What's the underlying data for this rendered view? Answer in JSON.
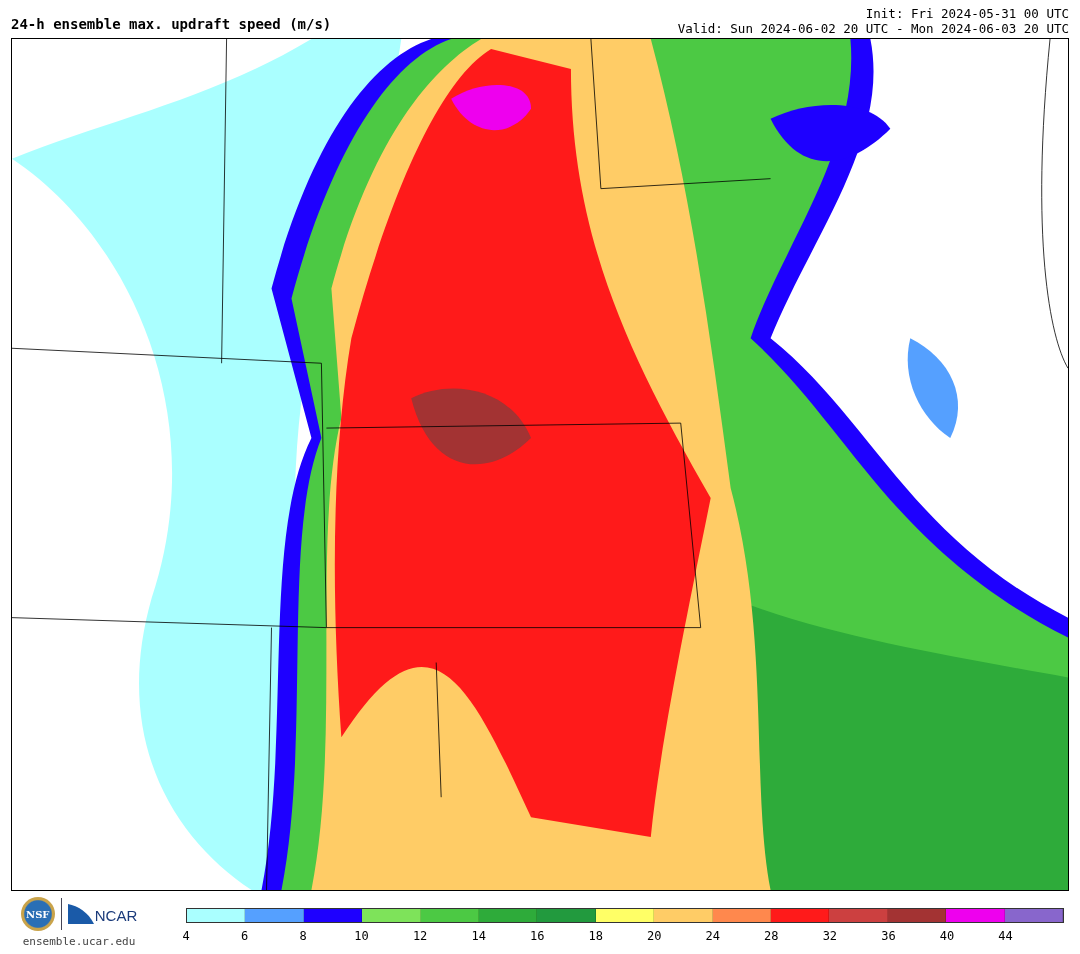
{
  "title": "24-h ensemble max. updraft speed (m/s)",
  "init": "Init: Fri 2024-05-31 00 UTC",
  "valid": "Valid: Sun 2024-06-02 20 UTC - Mon 2024-06-03 20 UTC",
  "footer": {
    "nsf_logo": "NSF",
    "ncar_logo": "NCAR",
    "url": "ensemble.ucar.edu"
  },
  "colorbar": {
    "segments": [
      {
        "color": "#aaffff"
      },
      {
        "color": "#55a0ff"
      },
      {
        "color": "#1e00ff"
      },
      {
        "color": "#7ee35a"
      },
      {
        "color": "#4cc944"
      },
      {
        "color": "#2eab3a"
      },
      {
        "color": "#229a3e"
      },
      {
        "color": "#ffff66"
      },
      {
        "color": "#ffcc66"
      },
      {
        "color": "#ff884d"
      },
      {
        "color": "#ff1a1a"
      },
      {
        "color": "#cc4040"
      },
      {
        "color": "#a33333"
      },
      {
        "color": "#ee00ee"
      },
      {
        "color": "#8866cc"
      }
    ],
    "ticks": [
      "4",
      "6",
      "8",
      "10",
      "12",
      "14",
      "16",
      "18",
      "20",
      "24",
      "28",
      "32",
      "36",
      "40",
      "44"
    ]
  }
}
